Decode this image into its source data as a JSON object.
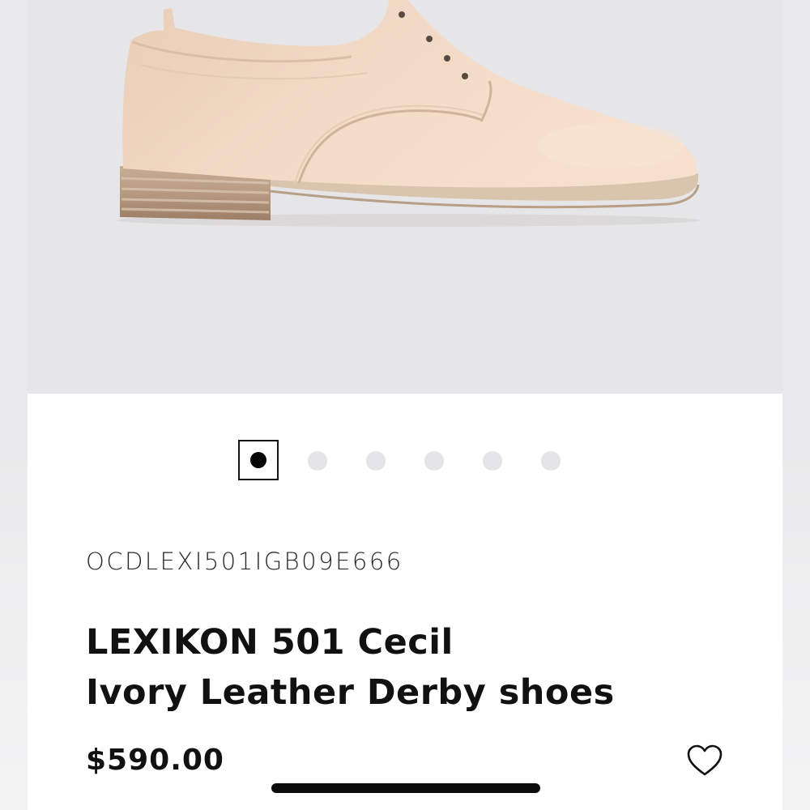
{
  "product": {
    "image_alt": "Ivory leather derby shoe",
    "image_count": 6,
    "active_image": 1,
    "sku": "OCDLEXI501IGB09E666",
    "title_line1": "LEXIKON 501 Cecil",
    "title_line2": "Ivory Leather Derby shoes",
    "price": "$590.00"
  },
  "icons": {
    "favorite": "heart-outline-icon"
  },
  "colors": {
    "image_background": "#e6e6e8",
    "text": "#111111",
    "active_dot": "#050505",
    "inactive_dot": "#e5e5e7"
  }
}
